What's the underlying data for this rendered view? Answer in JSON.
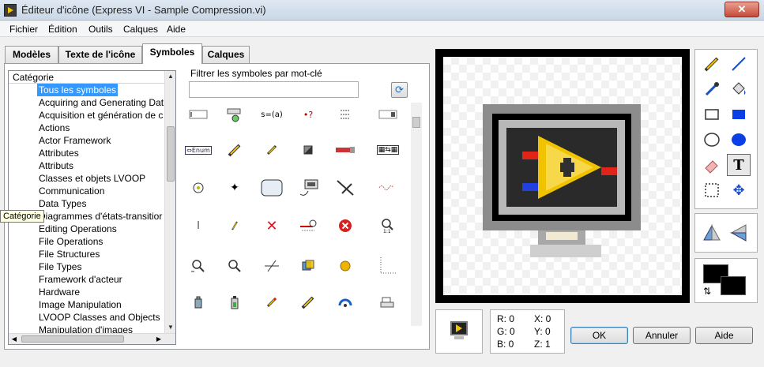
{
  "window": {
    "title": "Éditeur d'icône (Express VI - Sample Compression.vi)",
    "close_label": "✕"
  },
  "menu": [
    "Fichier",
    "Édition",
    "Outils",
    "Calques",
    "Aide"
  ],
  "tabs": [
    "Modèles",
    "Texte de l'icône",
    "Symboles",
    "Calques"
  ],
  "active_tab": "Symboles",
  "category_panel": {
    "header": "Catégorie",
    "tooltip": "Catégorie",
    "items": [
      "Tous les symboles",
      "Acquiring and Generating Dat",
      "Acquisition et génération de c",
      "Actions",
      "Actor Framework",
      "Attributes",
      "Attributs",
      "Classes et objets LVOOP",
      "Communication",
      "Data Types",
      "Diagrammes d'états-transitior",
      "Editing Operations",
      "File Operations",
      "File Structures",
      "File Types",
      "Framework d'acteur",
      "Hardware",
      "Image Manipulation",
      "LVOOP Classes and Objects",
      "Manipulation d'images"
    ],
    "selected_index": 0
  },
  "filter": {
    "label": "Filtrer les symboles par mot-clé",
    "value": "",
    "refresh_icon": "refresh-icon"
  },
  "symbol_icons": [
    "text-field",
    "button-pointer",
    "formula",
    "query",
    "list",
    "input-box",
    "enum",
    "pencil",
    "pencil-small",
    "square-half",
    "saw",
    "connector",
    "compass",
    "crosshair",
    "rounded-box",
    "monitor-loop",
    "probe",
    "wave",
    "text-cursor",
    "pencil-tiny",
    "red-x",
    "timer-arrow",
    "red-circle-x",
    "magnifier-1to1",
    "zoom-in",
    "zoom-out",
    "slope-line",
    "flip",
    "gold-circle",
    "dotted-corner",
    "bottle",
    "battery",
    "pencil-red",
    "pencil-yellow",
    "blue-arc",
    "printer"
  ],
  "tools": [
    "pencil-tool",
    "line-tool",
    "dropper-tool",
    "fill-tool",
    "rectangle-tool",
    "filled-rectangle-tool",
    "ellipse-tool",
    "filled-ellipse-tool",
    "eraser-tool",
    "text-tool",
    "selection-tool",
    "move-tool"
  ],
  "tools_extra": [
    "flip-horizontal-tool",
    "flip-vertical-tool"
  ],
  "colors": {
    "foreground": "#000000",
    "background": "#000000"
  },
  "pixel_info": {
    "r": "R: 0",
    "g": "G: 0",
    "b": "B: 0",
    "x": "X: 0",
    "y": "Y: 0",
    "z": "Z: 1"
  },
  "buttons": {
    "ok": "OK",
    "cancel": "Annuler",
    "help": "Aide"
  }
}
